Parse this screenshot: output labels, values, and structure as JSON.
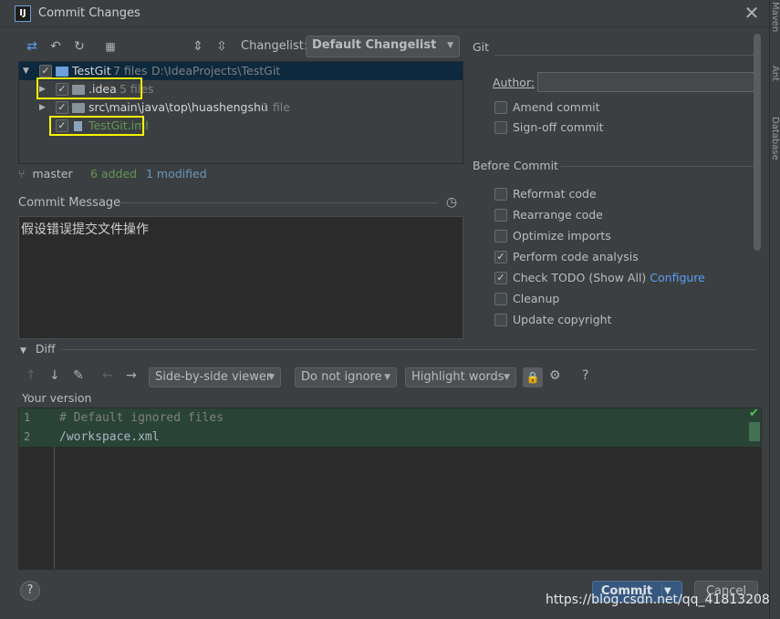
{
  "window": {
    "title": "Commit Changes",
    "app_icon": "IJ",
    "close": "✕"
  },
  "side_tools": [
    "Maven",
    "Ant",
    "Database"
  ],
  "toolbar": {
    "changelist_label": "Changelist:",
    "changelist_value": "Default Changelist"
  },
  "tree": {
    "root": {
      "name": "TestGit",
      "count": "7 files",
      "path": "D:\\IdeaProjects\\TestGit"
    },
    "items": [
      {
        "name": ".idea",
        "count": "5 files"
      },
      {
        "name": "src\\main\\java\\top\\huashengshu",
        "count": "1 file"
      },
      {
        "name": "TestGit.iml",
        "count": ""
      }
    ]
  },
  "status": {
    "branch": "master",
    "added": "6 added",
    "modified": "1 modified"
  },
  "commit_message": {
    "label": "Commit Message",
    "text": "假设错误提交文件操作"
  },
  "git": {
    "section": "Git",
    "author_label": "Author:",
    "author_value": "",
    "amend": "Amend commit",
    "signoff": "Sign-off commit"
  },
  "before_commit": {
    "section": "Before Commit",
    "options": [
      {
        "label": "Reformat code",
        "checked": false
      },
      {
        "label": "Rearrange code",
        "checked": false
      },
      {
        "label": "Optimize imports",
        "checked": false
      },
      {
        "label": "Perform code analysis",
        "checked": true
      },
      {
        "label": "Check TODO (Show All)",
        "checked": true,
        "link": "Configure"
      },
      {
        "label": "Cleanup",
        "checked": false
      },
      {
        "label": "Update copyright",
        "checked": false
      }
    ]
  },
  "diff": {
    "header": "Diff",
    "viewer": "Side-by-side viewer",
    "ignore": "Do not ignore",
    "highlight": "Highlight words",
    "help": "?",
    "your_version": "Your version",
    "lines": [
      {
        "num": "1",
        "text": "# Default ignored files"
      },
      {
        "num": "2",
        "text": "/workspace.xml"
      }
    ]
  },
  "buttons": {
    "help": "?",
    "commit": "Commit",
    "cancel": "Cancel"
  },
  "watermark": "https://blog.csdn.net/qq_41813208",
  "colors": {
    "background": "#3c3f41",
    "selection": "#0d293e",
    "diff_added": "#294436",
    "link": "#589df6",
    "highlight_box": "#f5f500",
    "commit_button": "#365880"
  }
}
